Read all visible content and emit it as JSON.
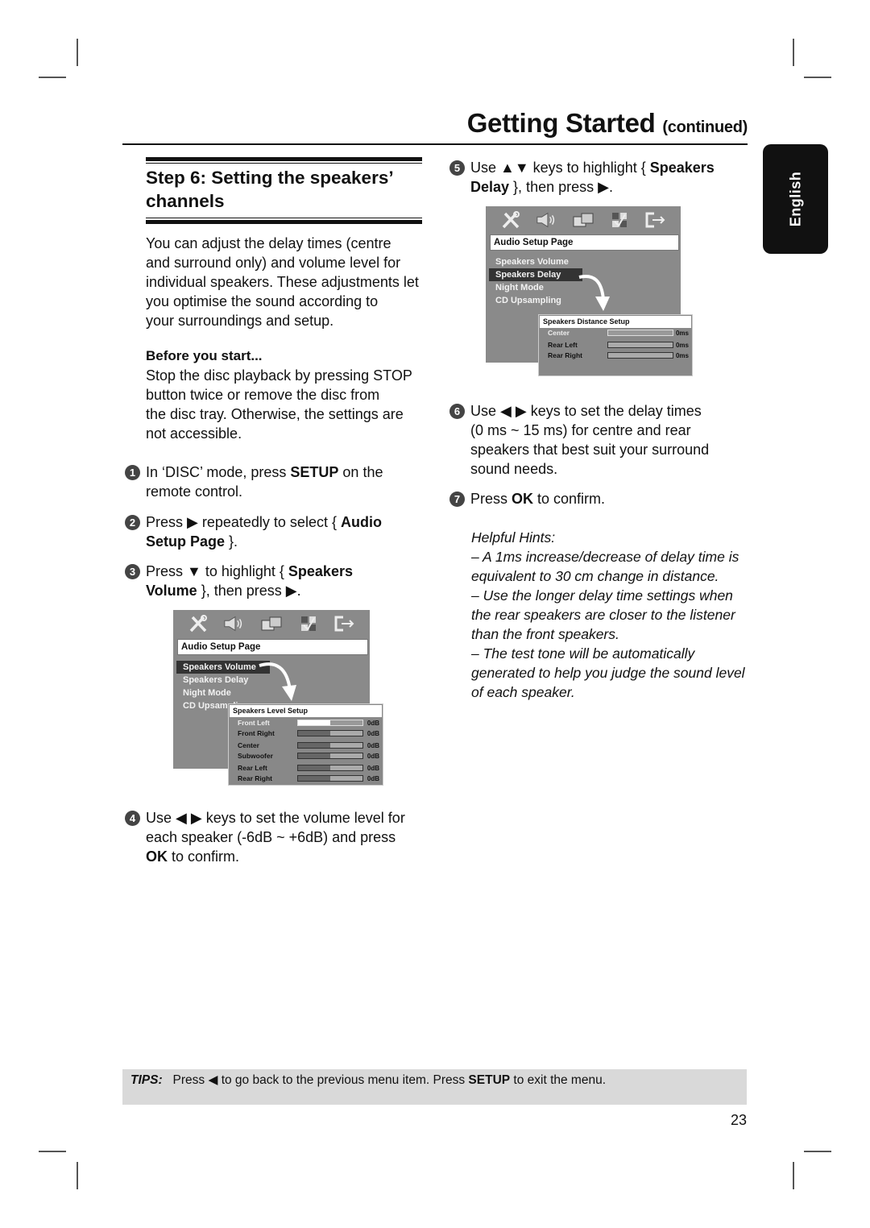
{
  "header": {
    "title": "Getting Started",
    "title_suffix": "(continued)",
    "language_tab": "English"
  },
  "section": {
    "heading_line1": "Step 6:  Setting the speakers’",
    "heading_line2": "channels",
    "intro_lines": [
      "You can adjust the delay times (centre",
      "and surround only) and volume level for",
      "individual speakers. These adjustments let",
      "you optimise the sound according to",
      "your surroundings and setup."
    ],
    "before_heading": "Before you start...",
    "before_lines": [
      "Stop the disc playback by pressing STOP",
      "button twice or remove the disc from",
      "the disc tray.  Otherwise, the settings are",
      "not accessible."
    ]
  },
  "steps": [
    {
      "number": "1",
      "lines": [
        [
          "In ‘DISC’ mode, press ",
          {
            "b": "SETUP"
          },
          " on the"
        ],
        [
          "remote control."
        ]
      ]
    },
    {
      "number": "2",
      "lines": [
        [
          "Press ▶ repeatedly to select { ",
          {
            "b": "Audio"
          }
        ],
        [
          {
            "b": "Setup Page"
          },
          " }."
        ]
      ]
    },
    {
      "number": "3",
      "lines": [
        [
          "Press ▼ to highlight { ",
          {
            "b": "Speakers"
          }
        ],
        [
          {
            "b": "Volume"
          },
          " }, then press ▶."
        ]
      ]
    },
    {
      "number": "4",
      "lines": [
        [
          "Use ◀ ▶ keys to set the volume level for"
        ],
        [
          "each speaker (-6dB ~ +6dB) and press"
        ],
        [
          {
            "b": "OK"
          },
          " to confirm."
        ]
      ]
    },
    {
      "number": "5",
      "lines": [
        [
          "Use ▲▼ keys to highlight { ",
          {
            "b": "Speakers"
          }
        ],
        [
          {
            "b": "Delay"
          },
          " }, then press ▶."
        ]
      ]
    },
    {
      "number": "6",
      "lines": [
        [
          "Use ◀ ▶ keys to set the delay times"
        ],
        [
          "(0 ms ~ 15 ms) for centre and rear"
        ],
        [
          "speakers that best suit your surround"
        ],
        [
          "sound needs."
        ]
      ]
    },
    {
      "number": "7",
      "lines": [
        [
          "Press ",
          {
            "b": "OK"
          },
          " to confirm."
        ]
      ]
    }
  ],
  "osd_icons": [
    "tools-icon",
    "speaker-icon",
    "film-icon",
    "checkbox-grid-icon",
    "exit-icon"
  ],
  "osd_volume": {
    "page_header": "Audio Setup Page",
    "menu_items": [
      "Speakers Volume",
      "Speakers Delay",
      "Night Mode",
      "CD Upsampling"
    ],
    "selected_index": 0,
    "submenu_title": "Speakers Level Setup",
    "submenu_rows": [
      {
        "label": "Front Left",
        "value": "0dB",
        "level": 0.5,
        "highlighted": true
      },
      {
        "label": "Front Right",
        "value": "0dB",
        "level": 0.5,
        "highlighted": false
      },
      {
        "label": "Center",
        "value": "0dB",
        "level": 0.5,
        "highlighted": false
      },
      {
        "label": "Subwoofer",
        "value": "0dB",
        "level": 0.5,
        "highlighted": false
      },
      {
        "label": "Rear Left",
        "value": "0dB",
        "level": 0.5,
        "highlighted": false
      },
      {
        "label": "Rear Right",
        "value": "0dB",
        "level": 0.5,
        "highlighted": false
      }
    ]
  },
  "osd_delay": {
    "page_header": "Audio Setup Page",
    "menu_items": [
      "Speakers Volume",
      "Speakers Delay",
      "Night Mode",
      "CD Upsampling"
    ],
    "selected_index": 1,
    "submenu_title": "Speakers Distance Setup",
    "submenu_rows": [
      {
        "label": "Center",
        "value": "0ms",
        "level": 0,
        "highlighted": true
      },
      {
        "label": "Rear Left",
        "value": "0ms",
        "level": 0,
        "highlighted": false
      },
      {
        "label": "Rear Right",
        "value": "0ms",
        "level": 0,
        "highlighted": false
      }
    ]
  },
  "hints": {
    "title": "Helpful Hints:",
    "lines": [
      "– A 1ms increase/decrease of delay time is",
      "equivalent to 30 cm change in distance.",
      "– Use the longer delay time settings when",
      "the rear speakers are closer to the listener",
      "than the front speakers.",
      "– The test tone will be automatically",
      "generated to help you judge the sound level",
      "of each speaker."
    ]
  },
  "tips": {
    "label": "TIPS:",
    "text_before": "Press ◀ to go back to the previous menu item.  Press ",
    "bold": "SETUP",
    "text_after": " to exit the menu."
  },
  "page_number": "23"
}
